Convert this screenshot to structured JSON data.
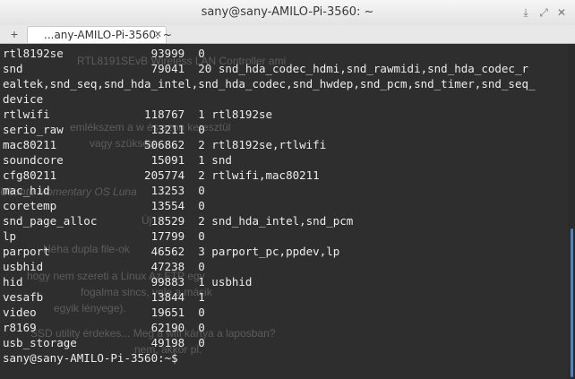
{
  "window": {
    "title": "sany@sany-AMILO-Pi-3560: ~",
    "buttons": {
      "minimize": "⤓",
      "restore": "⤢",
      "close": "✕"
    }
  },
  "tabs": [
    {
      "label": "...any-AMILO-Pi-3560: ~",
      "close": "✕"
    }
  ],
  "tabbar": {
    "new_tab": "+"
  },
  "terminal": {
    "lines": [
      "rtl8192se             93999  0",
      "snd                   79041  20 snd_hda_codec_hdmi,snd_rawmidi,snd_hda_codec_r",
      "ealtek,snd_seq,snd_hda_intel,snd_hda_codec,snd_hwdep,snd_pcm,snd_timer,snd_seq_",
      "device",
      "rtlwifi              118767  1 rtl8192se",
      "serio_raw             13211  0",
      "mac80211             506862  2 rtl8192se,rtlwifi",
      "soundcore             15091  1 snd",
      "cfg80211             205774  2 rtlwifi,mac80211",
      "mac_hid               13253  0",
      "coretemp              13554  0",
      "snd_page_alloc        18529  2 snd_hda_intel,snd_pcm",
      "lp                    17799  0",
      "parport               46562  3 parport_pc,ppdev,lp",
      "usbhid                47238  0",
      "hid                   99883  1 usbhid",
      "vesafb                13844  1",
      "video                 19651  0",
      "r8169                 62190  0",
      "usb_storage           49198  0",
      "sany@sany-AMILO-Pi-3560:~$"
    ],
    "background_text": [
      "RTL8191SEvB  Wireless  LAN  Controller  ami",
      "emlékszem a  w         és azon keresztül",
      "vagy szükség           ",
      "Ubuntu Momentary OS Luna",
      "Új",
      "Néha dupla file-ok",
      "hogy nem szereti a Linux                     Az FTP egy",
      "fogalma sincs,                     vele a másik",
      "egyik lényege).",
      "SSD utility érdekes...  Meg a wifi kártya a laposban?",
      "nem, akkor pl."
    ]
  },
  "colors": {
    "terminal_bg": "#2e2e2e",
    "terminal_fg": "#ececec",
    "scroll_thumb": "#3a88e0"
  }
}
